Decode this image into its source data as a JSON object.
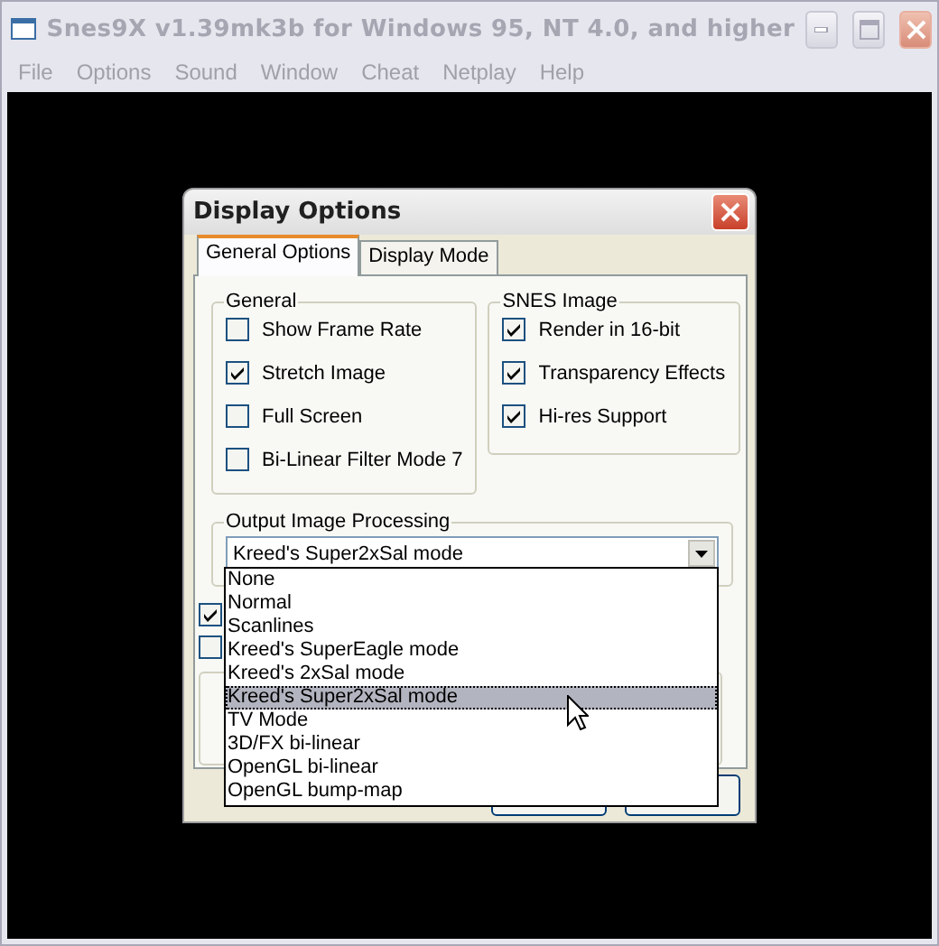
{
  "window": {
    "title": "Snes9X v1.39mk3b for Windows 95, NT 4.0, and higher",
    "active": false
  },
  "menu": [
    "File",
    "Options",
    "Sound",
    "Window",
    "Cheat",
    "Netplay",
    "Help"
  ],
  "dialog": {
    "title": "Display Options",
    "tabs": [
      {
        "label": "General Options",
        "selected": true
      },
      {
        "label": "Display Mode",
        "selected": false
      }
    ],
    "general": {
      "title": "General",
      "options": [
        {
          "label": "Show Frame Rate",
          "checked": false
        },
        {
          "label": "Stretch Image",
          "checked": true
        },
        {
          "label": "Full Screen",
          "checked": false
        },
        {
          "label": "Bi-Linear Filter Mode 7",
          "checked": false
        }
      ]
    },
    "snes_image": {
      "title": "SNES Image",
      "options": [
        {
          "label": "Render in 16-bit",
          "checked": true
        },
        {
          "label": "Transparency Effects",
          "checked": true
        },
        {
          "label": "Hi-res Support",
          "checked": true
        }
      ]
    },
    "output": {
      "title": "Output Image Processing",
      "value": "Kreed's Super2xSal mode",
      "expanded": true,
      "options": [
        {
          "label": "None",
          "selected": false
        },
        {
          "label": "Normal",
          "selected": false
        },
        {
          "label": "Scanlines",
          "selected": false
        },
        {
          "label": "Kreed's SuperEagle mode",
          "selected": false
        },
        {
          "label": "Kreed's 2xSal mode",
          "selected": false
        },
        {
          "label": "Kreed's Super2xSal mode",
          "selected": true
        },
        {
          "label": "TV Mode",
          "selected": false
        },
        {
          "label": "3D/FX bi-linear",
          "selected": false
        },
        {
          "label": "OpenGL bi-linear",
          "selected": false
        },
        {
          "label": "OpenGL bump-map",
          "selected": false
        }
      ]
    },
    "covered_checkboxes": [
      {
        "checked": true
      },
      {
        "checked": false
      }
    ]
  }
}
